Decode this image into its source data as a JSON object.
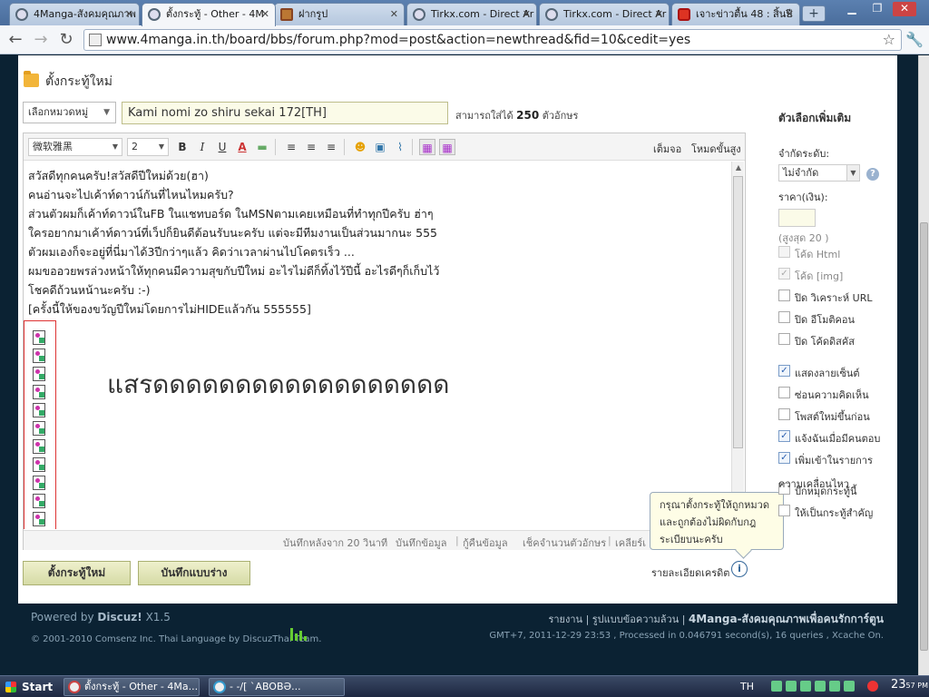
{
  "browser": {
    "tabs": [
      {
        "title": "4Manga-สังคมคุณภาพ",
        "active": false,
        "icon": "chrome-page-icon"
      },
      {
        "title": "ตั้งกระทู้ - Other - 4M",
        "active": true,
        "icon": "chrome-page-icon"
      },
      {
        "title": "ฝากรูป",
        "active": false,
        "icon": "image-host-icon"
      },
      {
        "title": "Tirkx.com - Direct Ar",
        "active": false,
        "icon": "chrome-page-icon"
      },
      {
        "title": "Tirkx.com - Direct Ar",
        "active": false,
        "icon": "chrome-page-icon"
      },
      {
        "title": "เจาะข่าวตื้น 48 : สิ้นปี",
        "active": false,
        "icon": "youtube-icon"
      }
    ],
    "url": "www.4manga.in.th/board/bbs/forum.php?mod=post&action=newthread&fid=10&cedit=yes"
  },
  "post": {
    "page_title": "ตั้งกระทู้ใหม่",
    "category_placeholder": "เลือกหมวดหมู่",
    "subject": "Kami nomi zo shiru sekai 172[TH]",
    "char_limit_prefix": "สามารถใส่ได้",
    "char_limit_value": "250",
    "char_limit_suffix": "ตัวอักษร"
  },
  "editor": {
    "font": "微软雅黑",
    "size": "2",
    "fullscreen_label": "เต็มจอ",
    "advanced_label": "โหมดขั้นสูง",
    "lines": [
      "สวัสดีทุกคนครับ!สวัสดีปีใหม่ด้วย(ฮา)",
      "คนอ่านจะไปเค้าท์ดาวน์กันที่ไหนไหมครับ?",
      "ส่วนตัวผมก็เค้าท์ดาวน์ในFB ในแชทบอร์ด ในMSNตามเคยเหมือนที่ทำทุกปีครับ ฮ่าๆ",
      "ใครอยากมาเค้าท์ดาวน์ที่เว็ปก็ยินดีต้อนรับนะครับ แต่จะมีทีมงานเป็นส่วนมากนะ 555",
      "ตัวผมเองก็จะอยู่ที่นี่มาได้3ปีกว่าๆแล้ว คิดว่าเวลาผ่านไปโคตรเร็ว ...",
      "ผมขออวยพรล่วงหน้าให้ทุกคนมีความสุขกับปีใหม่ อะไรไม่ดีก็ทิ้งไว้ปีนี้ อะไรดีๆก็เก็บไว้",
      "โชคดีถ้วนหน้านะครับ  :-)",
      "[ครั้งนี้ให้ของขวัญปีใหม่โดยการไม่HIDEแล้วกัน 555555]"
    ],
    "big_text": "แสรดดดดดดดดดดดดดดดดดด",
    "image_count": 11,
    "autosave": "บันทึกหลังจาก 20 วินาที",
    "save_data": "บันทึกข้อมูล",
    "restore_data": "กู้คืนข้อมูล",
    "count_chars": "เช็คจำนวนตัวอักษร",
    "clear": "เคลียร์เ"
  },
  "actions": {
    "submit": "ตั้งกระทู้ใหม่",
    "save_draft": "บันทึกแบบร่าง",
    "credit_detail": "รายละเอียดเครดิต",
    "tooltip": [
      "กรุณาตั้งกระทู้ให้ถูกหมวด",
      "และถูกต้องไม่ผิดกับกฎ",
      "ระเบียบนะครับ"
    ]
  },
  "sidebar": {
    "title": "ตัวเลือกเพิ่มเติม",
    "restrict_label": "จำกัดระดับ:",
    "restrict_value": "ไม่จำกัด",
    "price_label": "ราคา(เงิน):",
    "price_value": "",
    "price_max": "(สูงสุด 20 )",
    "options": [
      {
        "label": "โค้ด Html",
        "checked": false,
        "disabled": true
      },
      {
        "label": "โค้ด [img]",
        "checked": true,
        "disabled": true
      },
      {
        "label": "ปิด วิเคราะห์ URL",
        "checked": false,
        "disabled": false
      },
      {
        "label": "ปิด อีโมติคอน",
        "checked": false,
        "disabled": false
      },
      {
        "label": "ปิด โค้ดดิสคัส",
        "checked": false,
        "disabled": false
      },
      {
        "label": "แสดงลายเซ็นต์",
        "checked": true,
        "disabled": false
      },
      {
        "label": "ซ่อนความคิดเห็น",
        "checked": false,
        "disabled": false
      },
      {
        "label": "โพสต์ใหม่ขึ้นก่อน",
        "checked": false,
        "disabled": false
      },
      {
        "label": "แจ้งฉันเมื่อมีคนตอบ",
        "checked": true,
        "disabled": false
      },
      {
        "label": "เพิ่มเข้าในรายการ",
        "checked": true,
        "disabled": false
      },
      {
        "label": "ปักหมุดกระทู้นี้",
        "checked": false,
        "disabled": false
      },
      {
        "label": "ให้เป็นกระทู้สำคัญ",
        "checked": false,
        "disabled": false
      }
    ],
    "feed_continuation": "ความเคลื่อนไหว"
  },
  "footer": {
    "powered_prefix": "Powered by",
    "powered_name": "Discuz!",
    "powered_version": "X1.5",
    "copyright": "© 2001-2010 Comsenz Inc. Thai Language by DiscuzThai Team.",
    "report": "รายงาน",
    "text_mode": "รูปแบบข้อความล้วน",
    "site_name": "4Manga-สังคมคุณภาพเพื่อคนรักการ์ตูน",
    "stats": "GMT+7, 2011-12-29 23:53 , Processed in 0.046791 second(s), 16 queries , Xcache On."
  },
  "taskbar": {
    "start": "Start",
    "tasks": [
      "ตั้งกระทู้ - Other - 4Ma...",
      "-        -/[ `ABOBƏ..."
    ],
    "lang": "TH",
    "time": "23",
    "time_min": "57",
    "ampm": "PM"
  },
  "colors": {
    "page_bg": "#0b2233",
    "button_bg": "#d6dba6",
    "subject_bg": "#fbfbe8",
    "highlight_border": "#dd3333"
  }
}
